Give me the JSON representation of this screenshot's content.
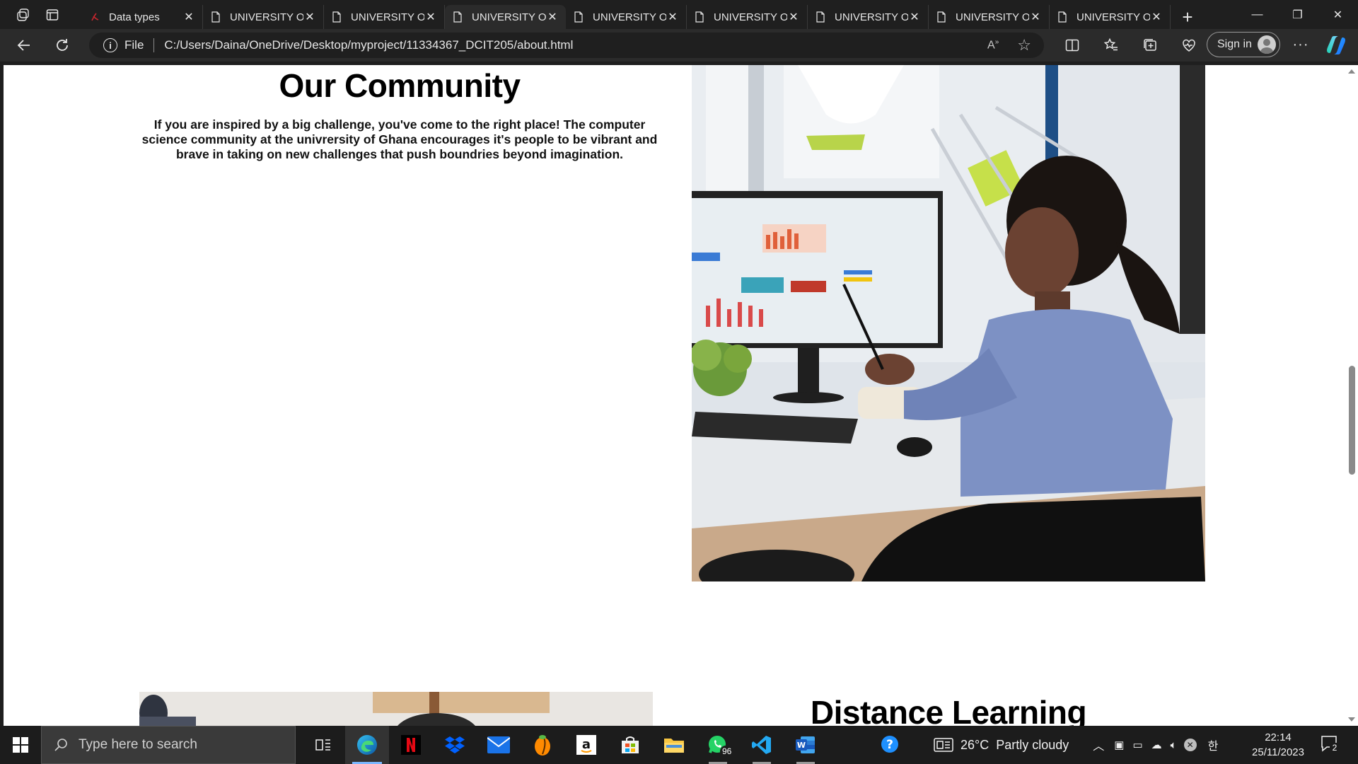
{
  "browser": {
    "tabs": [
      {
        "title": "Data types",
        "icon": "pdf-icon",
        "active": false
      },
      {
        "title": "UNIVERSITY OF",
        "icon": "page-icon",
        "active": false
      },
      {
        "title": "UNIVERSITY OF",
        "icon": "page-icon",
        "active": false
      },
      {
        "title": "UNIVERSITY OF",
        "icon": "page-icon",
        "active": true
      },
      {
        "title": "UNIVERSITY OF",
        "icon": "page-icon",
        "active": false
      },
      {
        "title": "UNIVERSITY OF",
        "icon": "page-icon",
        "active": false
      },
      {
        "title": "UNIVERSITY OF",
        "icon": "page-icon",
        "active": false
      },
      {
        "title": "UNIVERSITY OF",
        "icon": "page-icon",
        "active": false
      },
      {
        "title": "UNIVERSITY OF",
        "icon": "page-icon",
        "active": false
      }
    ],
    "address": {
      "scheme_label": "File",
      "url": "C:/Users/Daina/OneDrive/Desktop/myproject/11334367_DCIT205/about.html"
    },
    "read_aloud_label": "A",
    "signin_label": "Sign in"
  },
  "page": {
    "community": {
      "title": "Our Community",
      "text": "If you are inspired by a big challenge, you've come to the right place! The computer science community at the univrersity of Ghana encourages it's people to be vibrant and brave in taking on new challenges that push boundries beyond imagination."
    },
    "distance": {
      "title": "Distance Learning"
    }
  },
  "taskbar": {
    "search_placeholder": "Type here to search",
    "whatsapp_badge": "96",
    "weather": "26°C  Partly cloudy",
    "time": "22:14",
    "date": "25/11/2023",
    "notification_count": "2"
  },
  "colors": {
    "browser_bg": "#1f1f1f",
    "toolbar_bg": "#2b2b2b",
    "taskbar_bg": "#1c1c1c",
    "accent": "#7bb7ff"
  }
}
